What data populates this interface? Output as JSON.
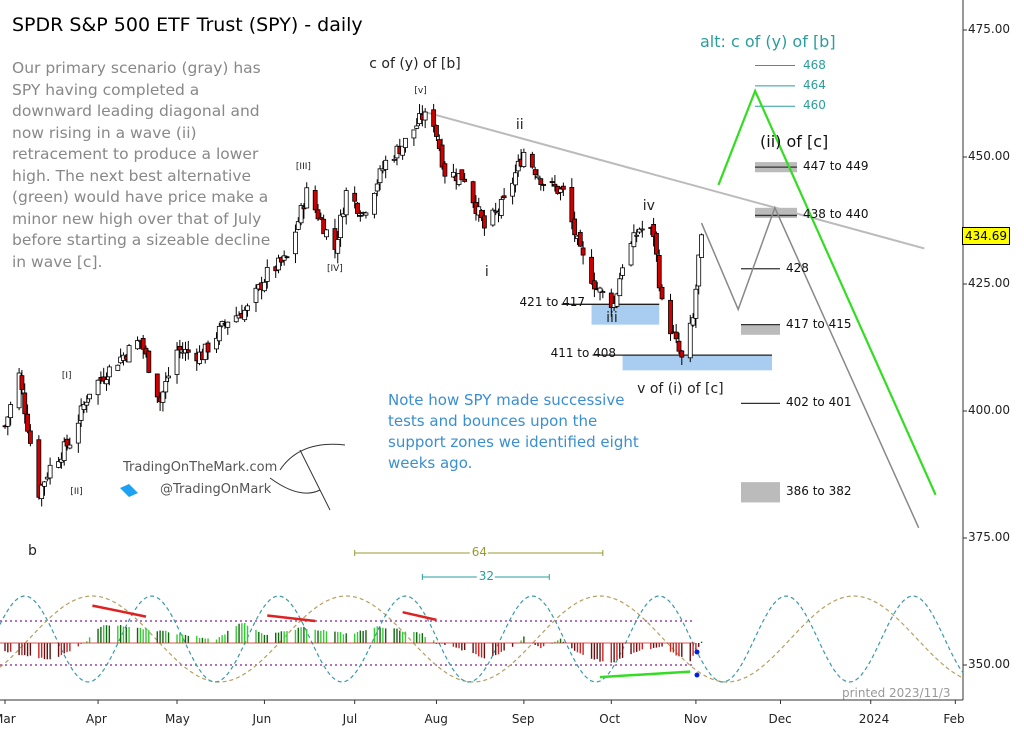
{
  "title": "SPDR S&P 500 ETF Trust (SPY) - daily",
  "description": "Our primary scenario (gray) has SPY having completed a downward leading diagonal and now rising in a wave (ii) retracement to produce a lower high. The next best alternative (green) would have price make a minor new high over that of July before starting a sizeable decline in wave [c].",
  "note": "Note how SPY made successive tests and bounces upon the support zones we identified eight weeks ago.",
  "branding": {
    "site": "TradingOnTheMark.com",
    "twitter": "@TradingOnMark"
  },
  "printed": "printed 2023/11/3",
  "chart_data": {
    "type": "candlestick",
    "title": "SPDR S&P 500 ETF Trust (SPY) - daily",
    "last_price": "434.69",
    "ylim": [
      340,
      480
    ],
    "y_ticks": [
      "475.00",
      "450.00",
      "425.00",
      "400.00",
      "375.00",
      "350.00"
    ],
    "x_ticks": [
      {
        "label": "Mar",
        "date": "2023-03-01"
      },
      {
        "label": "Apr",
        "date": "2023-04-03"
      },
      {
        "label": "May",
        "date": "2023-05-01"
      },
      {
        "label": "Jun",
        "date": "2023-06-01"
      },
      {
        "label": "Jul",
        "date": "2023-07-03"
      },
      {
        "label": "Aug",
        "date": "2023-08-01"
      },
      {
        "label": "Sep",
        "date": "2023-09-01"
      },
      {
        "label": "Oct",
        "date": "2023-10-02"
      },
      {
        "label": "Nov",
        "date": "2023-11-01"
      },
      {
        "label": "Dec",
        "date": "2023-12-01"
      },
      {
        "label": "2024",
        "date": "2024-01-02"
      },
      {
        "label": "Feb",
        "date": "2024-02-01"
      }
    ],
    "x_range": [
      "2023-02-28",
      "2024-02-03"
    ],
    "price_path": [
      [
        "2023-03-01",
        397
      ],
      [
        "2023-03-06",
        407
      ],
      [
        "2023-03-13",
        384
      ],
      [
        "2023-03-17",
        389
      ],
      [
        "2023-03-24",
        394
      ],
      [
        "2023-03-31",
        404
      ],
      [
        "2023-04-10",
        410
      ],
      [
        "2023-04-18",
        414
      ],
      [
        "2023-04-25",
        402
      ],
      [
        "2023-05-01",
        412
      ],
      [
        "2023-05-10",
        411
      ],
      [
        "2023-05-19",
        418
      ],
      [
        "2023-05-26",
        420
      ],
      [
        "2023-06-02",
        427
      ],
      [
        "2023-06-09",
        430
      ],
      [
        "2023-06-16",
        443
      ],
      [
        "2023-06-26",
        432
      ],
      [
        "2023-06-30",
        443
      ],
      [
        "2023-07-06",
        439
      ],
      [
        "2023-07-14",
        449
      ],
      [
        "2023-07-21",
        453
      ],
      [
        "2023-07-27",
        458
      ],
      [
        "2023-07-31",
        457
      ],
      [
        "2023-08-04",
        447
      ],
      [
        "2023-08-11",
        446
      ],
      [
        "2023-08-18",
        436
      ],
      [
        "2023-08-25",
        441
      ],
      [
        "2023-09-01",
        451
      ],
      [
        "2023-09-08",
        445
      ],
      [
        "2023-09-15",
        443
      ],
      [
        "2023-09-21",
        431
      ],
      [
        "2023-09-27",
        424
      ],
      [
        "2023-10-03",
        421
      ],
      [
        "2023-10-06",
        429
      ],
      [
        "2023-10-12",
        436
      ],
      [
        "2023-10-17",
        435
      ],
      [
        "2023-10-20",
        421
      ],
      [
        "2023-10-27",
        410
      ],
      [
        "2023-10-31",
        418
      ],
      [
        "2023-11-02",
        430
      ],
      [
        "2023-11-03",
        434.69
      ]
    ],
    "trendline": [
      [
        "2023-07-27",
        459
      ],
      [
        "2024-01-21",
        432
      ]
    ],
    "wave_labels": [
      {
        "t": "c of (y) of [b]",
        "d": "2023-07-11",
        "p": 468
      },
      {
        "t": "[v]",
        "d": "2023-07-27",
        "p": 462,
        "s": 1
      },
      {
        "t": "ii",
        "d": "2023-09-01",
        "p": 456
      },
      {
        "t": "i",
        "d": "2023-08-21",
        "p": 427
      },
      {
        "t": "iv",
        "d": "2023-10-16",
        "p": 440
      },
      {
        "t": "iii",
        "d": "2023-10-03",
        "p": 418
      },
      {
        "t": "v of (i) of [c]",
        "d": "2023-10-14",
        "p": 404
      },
      {
        "t": "[III]",
        "d": "2023-06-15",
        "p": 447,
        "s": 1
      },
      {
        "t": "[IV]",
        "d": "2023-06-26",
        "p": 427,
        "s": 1
      },
      {
        "t": "[I]",
        "d": "2023-03-24",
        "p": 406,
        "s": 1
      },
      {
        "t": "[II]",
        "d": "2023-03-27",
        "p": 383,
        "s": 1
      },
      {
        "t": "b",
        "d": "2023-03-12",
        "p": 372
      }
    ],
    "support_zones": [
      {
        "label": "421 to 417",
        "low": 417,
        "high": 421,
        "from": "2023-09-25",
        "to": "2023-10-19"
      },
      {
        "label": "411 to 408",
        "low": 408,
        "high": 411,
        "from": "2023-10-06",
        "to": "2023-11-28"
      }
    ],
    "target_levels": [
      {
        "label": "447 to 449",
        "low": 447,
        "high": 449,
        "line": 448
      },
      {
        "label": "438 to 440",
        "low": 438,
        "high": 440,
        "line": 438.5
      },
      {
        "label": "428",
        "line": 428
      },
      {
        "label": "417 to 415",
        "low": 415,
        "high": 417,
        "line": 417
      },
      {
        "label": "402 to 401",
        "line": 401.5
      },
      {
        "label": "386 to 382",
        "low": 382,
        "high": 386
      }
    ],
    "alt_levels": [
      {
        "label": "468",
        "p": 468
      },
      {
        "label": "464",
        "p": 464
      },
      {
        "label": "460",
        "p": 460
      }
    ],
    "alt_label": "alt: c of (y) of [b]",
    "primary_label": "(ii) of [c]",
    "primary_projection": {
      "color": "#888888",
      "points": [
        [
          "2023-11-03",
          437
        ],
        [
          "2023-11-16",
          420
        ],
        [
          "2023-11-29",
          440
        ],
        [
          "2024-01-19",
          377
        ]
      ]
    },
    "alt_projection": {
      "color": "#33dd22",
      "points": [
        [
          "2023-11-09",
          444.5
        ],
        [
          "2023-11-22",
          463
        ],
        [
          "2024-01-25",
          383.5
        ]
      ]
    },
    "cycles": [
      {
        "label": "64",
        "color": "#b5a060",
        "peak": "2023-04-01",
        "period_days": 90
      },
      {
        "label": "32",
        "color": "#3a9aa8",
        "peak": "2023-04-22",
        "period_days": 45
      }
    ],
    "oscillator": {
      "up_color": "#33cc33",
      "down_color": "#cc2222",
      "bands": [
        1,
        -1
      ],
      "values": [
        [
          "2023-03-01",
          -0.4
        ],
        [
          "2023-03-10",
          -0.6
        ],
        [
          "2023-03-17",
          -0.75
        ],
        [
          "2023-03-25",
          -0.3
        ],
        [
          "2023-03-29",
          0
        ],
        [
          "2023-04-05",
          0.85
        ],
        [
          "2023-04-20",
          0.65
        ],
        [
          "2023-05-05",
          0.35
        ],
        [
          "2023-05-15",
          0.15
        ],
        [
          "2023-05-24",
          0.95
        ],
        [
          "2023-06-02",
          0.35
        ],
        [
          "2023-06-15",
          0.7
        ],
        [
          "2023-07-01",
          0.4
        ],
        [
          "2023-07-12",
          0.75
        ],
        [
          "2023-07-27",
          0.4
        ],
        [
          "2023-08-01",
          0
        ],
        [
          "2023-08-10",
          -0.3
        ],
        [
          "2023-08-19",
          -0.75
        ],
        [
          "2023-08-28",
          -0.15
        ],
        [
          "2023-09-01",
          0.25
        ],
        [
          "2023-09-07",
          -0.2
        ],
        [
          "2023-09-14",
          0.15
        ],
        [
          "2023-09-19",
          -0.4
        ],
        [
          "2023-10-01",
          -0.95
        ],
        [
          "2023-10-12",
          -0.35
        ],
        [
          "2023-10-20",
          -0.2
        ],
        [
          "2023-10-30",
          -0.85
        ],
        [
          "2023-11-03",
          0.1
        ]
      ],
      "divergences": [
        {
          "color": "#dd2222",
          "from": [
            "2023-04-01",
            1.7
          ],
          "to": [
            "2023-04-20",
            1.2
          ]
        },
        {
          "color": "#dd2222",
          "from": [
            "2023-06-02",
            1.25
          ],
          "to": [
            "2023-06-19",
            1.0
          ]
        },
        {
          "color": "#dd2222",
          "from": [
            "2023-07-20",
            1.4
          ],
          "to": [
            "2023-08-01",
            1.05
          ]
        },
        {
          "color": "#33dd22",
          "from": [
            "2023-09-28",
            -1.55
          ],
          "to": [
            "2023-10-30",
            -1.3
          ]
        }
      ]
    },
    "brackets": [
      {
        "label": "64",
        "from": "2023-07-03",
        "to": "2023-09-29",
        "color": "#999933"
      },
      {
        "label": "32",
        "from": "2023-07-27",
        "to": "2023-09-10",
        "color": "#2a9d9d"
      }
    ]
  }
}
